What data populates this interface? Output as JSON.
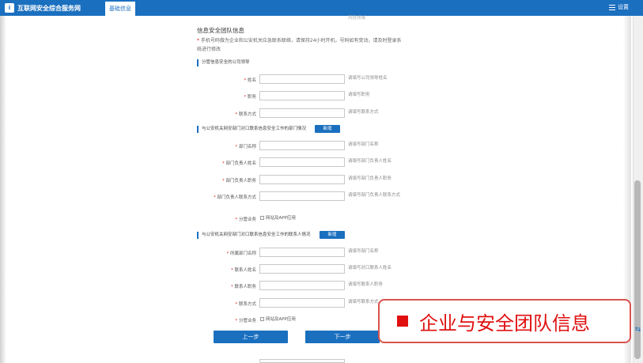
{
  "header": {
    "logo_text": "互联网安全综合服务网",
    "logo_mark": "i",
    "active_tab": "基础信息",
    "settings_label": "设置"
  },
  "page": {
    "faded_top_text": "风险领域",
    "section_title": "信息安全团队信息",
    "notice_star": "*",
    "notice_text": "手机号码做为企业和公安机关应急联系联络，请保持24小时开机，号码如有变动，请及时登录系统进行修改"
  },
  "group1": {
    "title": "分管信息安全的公司领导",
    "fields": [
      {
        "label": "姓名",
        "hint": "请填写公司领导姓名"
      },
      {
        "label": "职务",
        "hint": "请填写职务"
      },
      {
        "label": "联系方式",
        "hint": "请填写联系方式"
      }
    ]
  },
  "group2": {
    "title": "与公安机关网安部门对口联系信息安全工作的部门情况",
    "add_label": "新增",
    "fields": [
      {
        "label": "部门名称",
        "hint": "请填写部门名称"
      },
      {
        "label": "部门负责人姓名",
        "hint": "请填写部门负责人姓名"
      },
      {
        "label": "部门负责人职务",
        "hint": "请填写部门负责人职务"
      },
      {
        "label": "部门负责人联系方式",
        "hint": "请填写部门负责人联系方式"
      }
    ],
    "business_label": "分管业务",
    "business_option": "网站及APP应用"
  },
  "group3": {
    "title": "与公安机关网安部门对口联系信息安全工作的联系人情况",
    "add_label": "新增",
    "fields": [
      {
        "label": "所属部门名称",
        "hint": "请填写部门名称"
      },
      {
        "label": "联系人姓名",
        "hint": "请填写对口联系人姓名"
      },
      {
        "label": "联系人职务",
        "hint": "请填写联系人职务"
      },
      {
        "label": "联系方式",
        "hint": "请填写联系方式"
      }
    ],
    "business_label": "分管业务",
    "business_option": "网站及APP应用"
  },
  "nav": {
    "prev_label": "上一步",
    "next_label": "下一步"
  },
  "callout": {
    "text": "企业与安全团队信息"
  }
}
